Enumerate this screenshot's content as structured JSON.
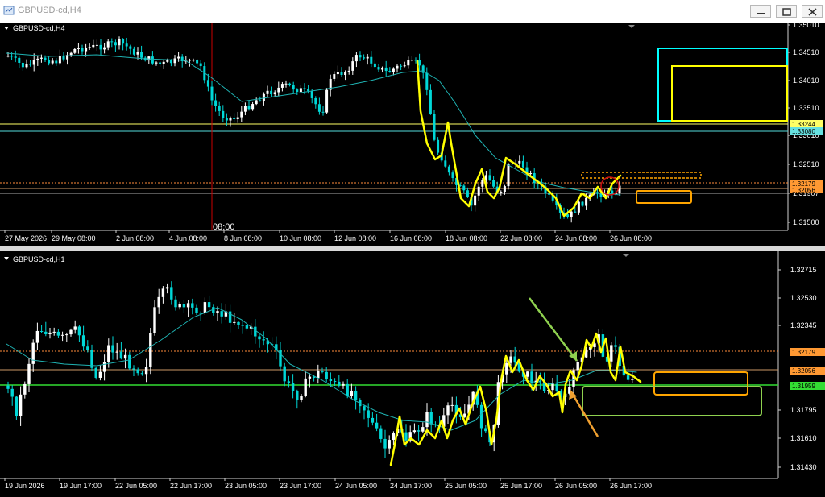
{
  "window": {
    "title": "GBPUSD-cd,H4"
  },
  "colors": {
    "bull": "#ffffff",
    "bear": "#00d7d7",
    "ma": "#1fb3b3",
    "yellow": "#ffff00",
    "orange": "#ffa500",
    "green": "#7cfc00",
    "cyan": "#00ffff"
  },
  "top_chart": {
    "label": "GBPUSD-cd,H4",
    "price_ticks": [
      "1.35010",
      "1.34510",
      "1.34010",
      "1.33510",
      "1.33010",
      "1.32510",
      "1.31907",
      "1.31500"
    ],
    "date_labels": [
      "27 May 2026",
      "29 May 08:00",
      "2 Jun 08:00",
      "4 Jun 08:00",
      "8 Jun 08:00",
      "10 Jun 08:00",
      "12 Jun 08:00",
      "16 Jun 08:00",
      "18 Jun 08:00",
      "22 Jun 08:00",
      "24 Jun 08:00",
      "26 Jun 08:00"
    ],
    "cursor_time": "08:00",
    "level_tags": [
      {
        "text": "1.33244",
        "bg": "#ffff66"
      },
      {
        "text": "1.33080",
        "bg": "#66e0e0"
      },
      {
        "text": "1.32179",
        "bg": "#ff9933"
      },
      {
        "text": "1.32056",
        "bg": "#ff9933"
      }
    ]
  },
  "bottom_chart": {
    "label": "GBPUSD-cd,H1",
    "price_ticks": [
      "1.32715",
      "1.32530",
      "1.32345",
      "1.31795",
      "1.31610",
      "1.31430"
    ],
    "date_labels": [
      "19 Jun 2026",
      "19 Jun 17:00",
      "22 Jun 05:00",
      "22 Jun 17:00",
      "23 Jun 05:00",
      "23 Jun 17:00",
      "24 Jun 05:00",
      "24 Jun 17:00",
      "25 Jun 05:00",
      "25 Jun 17:00",
      "26 Jun 05:00",
      "26 Jun 17:00"
    ],
    "level_tags": [
      {
        "text": "1.32179",
        "bg": "#ff9933"
      },
      {
        "text": "1.32056",
        "bg": "#ff9933"
      },
      {
        "text": "1.31959",
        "bg": "#33dd33"
      }
    ]
  }
}
